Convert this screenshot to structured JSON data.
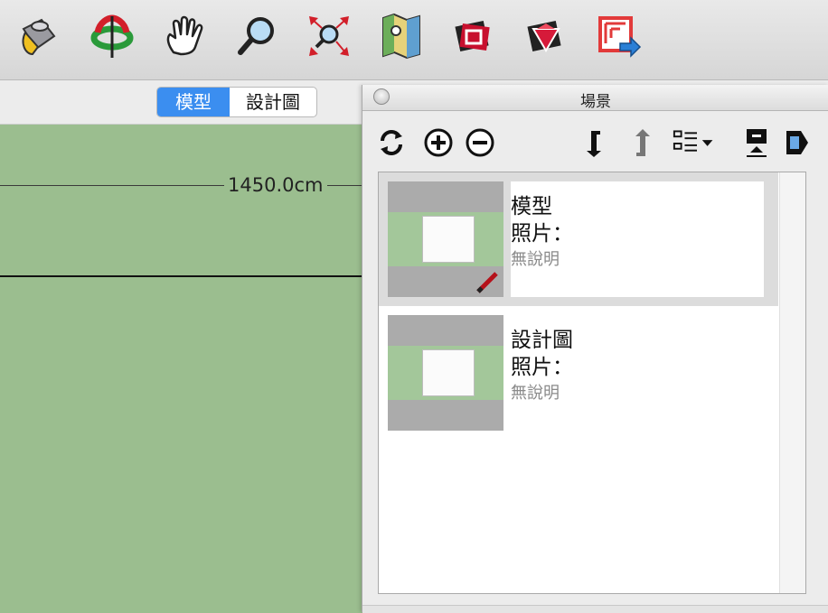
{
  "toolbar": {
    "tools": [
      {
        "name": "paint-bucket-icon"
      },
      {
        "name": "orbit-icon"
      },
      {
        "name": "pan-hand-icon"
      },
      {
        "name": "zoom-icon"
      },
      {
        "name": "zoom-extents-icon"
      },
      {
        "name": "add-location-icon"
      },
      {
        "name": "3d-warehouse-icon"
      },
      {
        "name": "extension-warehouse-icon"
      },
      {
        "name": "layout-export-icon"
      }
    ]
  },
  "tabs": [
    "模型",
    "設計圖"
  ],
  "viewport": {
    "dimension": "1450.0cm"
  },
  "panel": {
    "title": "場景",
    "tools": [
      {
        "name": "refresh-icon"
      },
      {
        "name": "add-scene-icon"
      },
      {
        "name": "remove-scene-icon"
      },
      {
        "name": "move-down-icon"
      },
      {
        "name": "move-up-icon"
      },
      {
        "name": "view-options-icon"
      },
      {
        "name": "thumbnail-toggle-icon"
      },
      {
        "name": "details-toggle-icon"
      }
    ],
    "scenes": [
      {
        "name": "模型",
        "photo": "照片：",
        "desc": "無說明",
        "selected": true
      },
      {
        "name": "設計圖",
        "photo": "照片：",
        "desc": "無說明",
        "selected": false
      }
    ]
  },
  "colors": {
    "viewport_bg": "#9bbe8f",
    "tab_active": "#3b8ef0"
  }
}
